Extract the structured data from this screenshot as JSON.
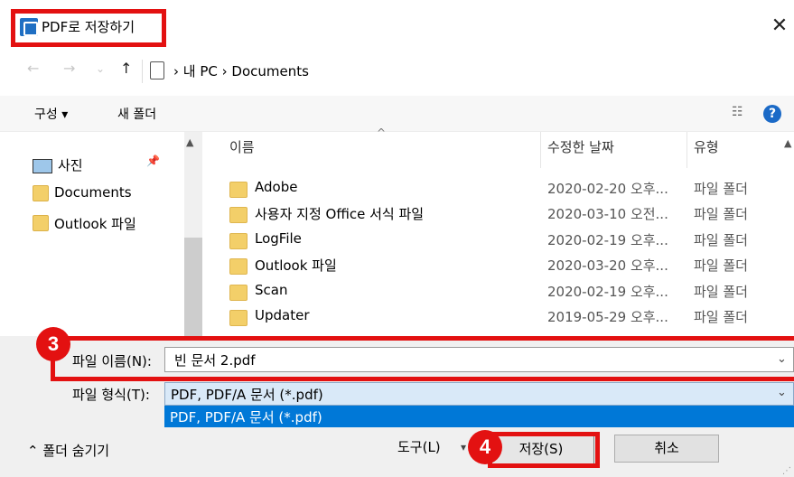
{
  "window": {
    "title": "PDF로 저장하기",
    "close": "✕"
  },
  "nav": {
    "back": "←",
    "forward": "→",
    "history": "⌄",
    "up": "↑",
    "path": "› 내 PC › Documents"
  },
  "toolbar": {
    "organize": "구성 ▾",
    "new_folder": "새 폴더",
    "view": "☷",
    "help": "?"
  },
  "sidebar": {
    "items": [
      {
        "label": "사진",
        "icon": "photo-icon"
      },
      {
        "label": "Documents",
        "icon": "folder-icon"
      },
      {
        "label": "Outlook 파일",
        "icon": "folder-icon"
      }
    ]
  },
  "columns": {
    "name": "이름",
    "date": "수정한 날짜",
    "type": "유형"
  },
  "files": [
    {
      "name": "Adobe",
      "date": "2020-02-20 오후...",
      "type": "파일 폴더"
    },
    {
      "name": "사용자 지정 Office 서식 파일",
      "date": "2020-03-10 오전...",
      "type": "파일 폴더"
    },
    {
      "name": "LogFile",
      "date": "2020-02-19 오후...",
      "type": "파일 폴더"
    },
    {
      "name": "Outlook 파일",
      "date": "2020-03-20 오후...",
      "type": "파일 폴더"
    },
    {
      "name": "Scan",
      "date": "2020-02-19 오후...",
      "type": "파일 폴더"
    },
    {
      "name": "Updater",
      "date": "2019-05-29 오후...",
      "type": "파일 폴더"
    }
  ],
  "form": {
    "filename_label": "파일 이름(N):",
    "filename_value": "빈 문서 2.pdf",
    "filetype_label": "파일 형식(T):",
    "filetype_value": "PDF, PDF/A 문서 (*.pdf)",
    "filetype_option": "PDF, PDF/A 문서 (*.pdf)"
  },
  "footer": {
    "hide_folders": "⌃ 폴더 숨기기",
    "tools": "도구(L)",
    "save": "저장(S)",
    "cancel": "취소"
  },
  "annotations": {
    "step3": "3",
    "step4": "4"
  },
  "colors": {
    "highlight": "#e31111",
    "accent": "#0078d7",
    "folder": "#f3cf69"
  }
}
